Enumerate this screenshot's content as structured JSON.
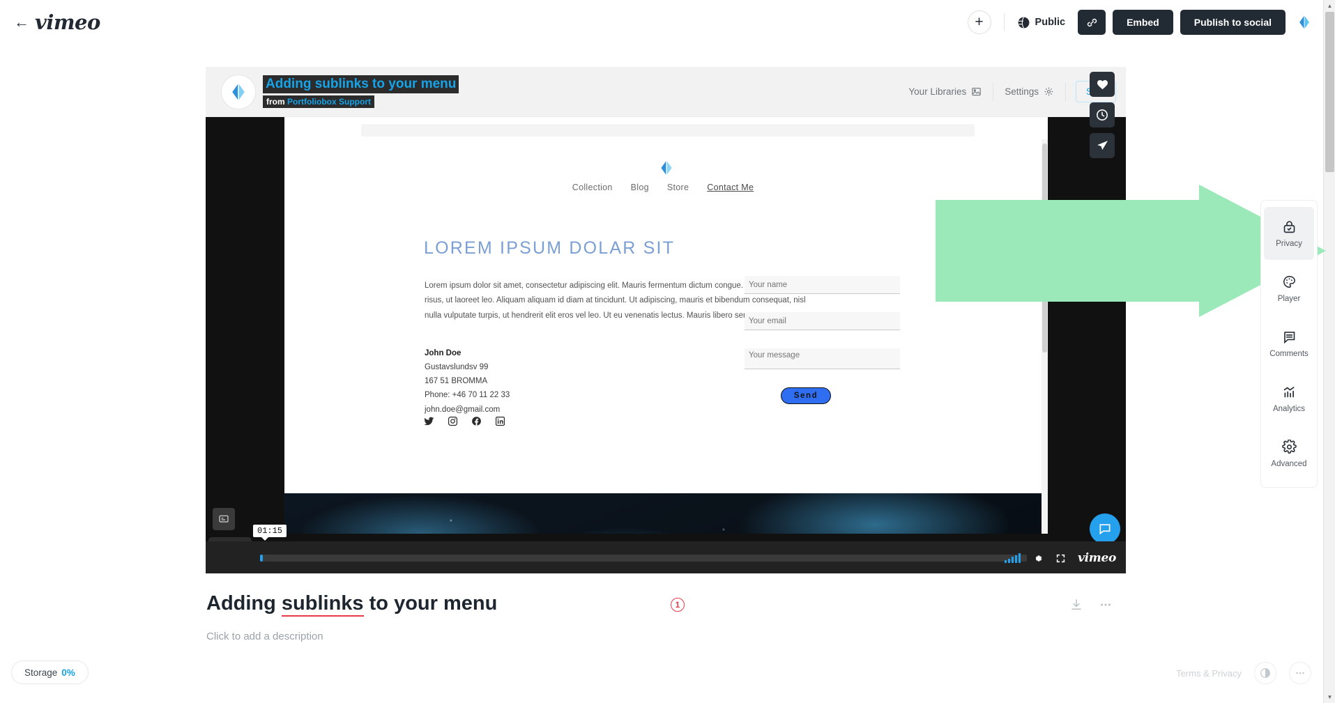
{
  "header": {
    "back_label": "←",
    "logo": "vimeo",
    "add_label": "+",
    "privacy_label": "Public",
    "link_button": "link-icon",
    "embed_label": "Embed",
    "publish_label": "Publish to social"
  },
  "player": {
    "title": "Adding sublinks to your menu",
    "from_prefix": "from",
    "from_channel": "Portfoliobox Support",
    "libraries_label": "Your Libraries",
    "settings_label": "Settings",
    "see_label": "See",
    "current_time": "01:15",
    "vimeo_mark": "vimeo",
    "fabs": [
      "heart-icon",
      "clock-icon",
      "share-icon"
    ]
  },
  "stage": {
    "nav": [
      "Collection",
      "Blog",
      "Store",
      "Contact Me"
    ],
    "active_nav": "Contact Me",
    "heading": "LOREM IPSUM DOLAR SIT",
    "body": "Lorem ipsum dolor sit amet, consectetur adipiscing elit. Mauris fermentum dictum congue. Vivamus sed porta risus, ut laoreet leo. Aliquam aliquam id diam at tincidunt. Ut adipiscing, mauris et bibendum consequat, nisl nulla vulputate turpis, ut hendrerit elit eros vel leo. Ut eu venenatis lectus. Mauris libero sem.",
    "contact": {
      "name": "John Doe",
      "street": "Gustavslundsv 99",
      "city": "167 51 BROMMA",
      "phone": "Phone: +46 70 11 22 33",
      "email": "john.doe@gmail.com"
    },
    "social": [
      "twitter-icon",
      "instagram-icon",
      "facebook-icon",
      "linkedin-icon"
    ],
    "form": {
      "name_placeholder": "Your name",
      "email_placeholder": "Your email",
      "message_placeholder": "Your message",
      "send_label": "Send"
    }
  },
  "rail": {
    "items": [
      {
        "label": "Privacy",
        "icon": "lock-icon",
        "active": true
      },
      {
        "label": "Player",
        "icon": "palette-icon",
        "active": false
      },
      {
        "label": "Comments",
        "icon": "comment-icon",
        "active": false
      },
      {
        "label": "Analytics",
        "icon": "analytics-icon",
        "active": false
      },
      {
        "label": "Advanced",
        "icon": "gear-icon",
        "active": false
      }
    ]
  },
  "meta": {
    "title_part1": "Adding ",
    "title_underlined": "sublinks",
    "title_part2": " to your menu",
    "description_placeholder": "Click to add a description",
    "annotation_1": "1"
  },
  "footer": {
    "storage_label": "Storage",
    "storage_value": "0%",
    "terms_label": "Terms & Privacy"
  },
  "colors": {
    "accent_blue": "#17a3e8",
    "dark": "#222a33",
    "annotation_red": "#e8394a",
    "arrow_green": "#9be8b9"
  }
}
